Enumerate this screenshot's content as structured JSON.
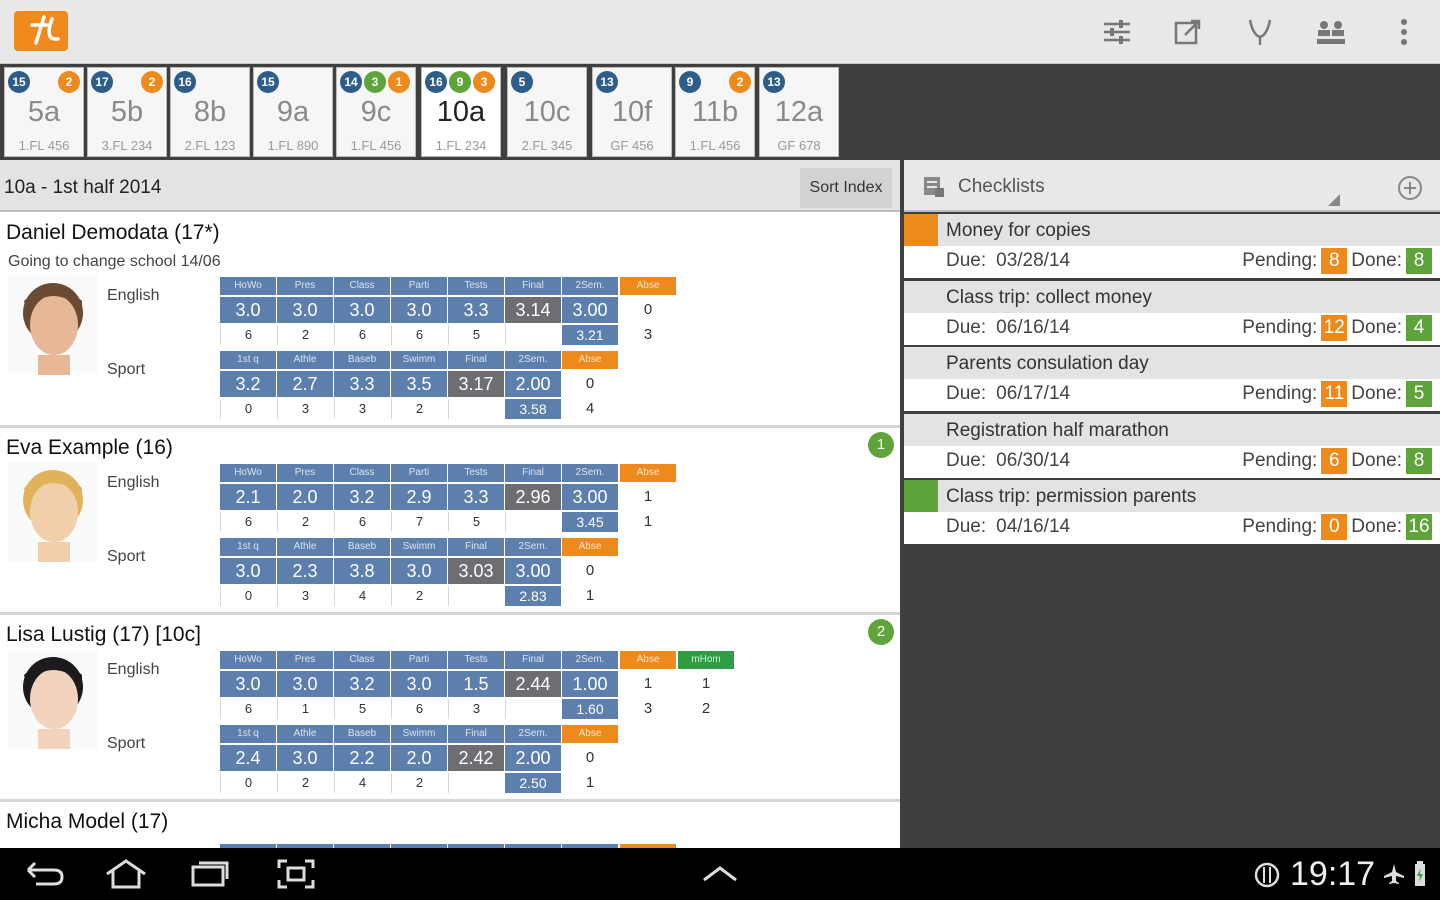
{
  "app": {
    "actions": [
      "sliders-icon",
      "export-icon",
      "fork-icon",
      "group-icon",
      "overflow-icon"
    ]
  },
  "classes": [
    {
      "name": "5a",
      "room": "1.FL 456",
      "badges": [
        {
          "v": "15",
          "c": "blue"
        },
        {
          "v": "2",
          "c": "orange"
        }
      ]
    },
    {
      "name": "5b",
      "room": "3.FL 234",
      "badges": [
        {
          "v": "17",
          "c": "blue"
        },
        {
          "v": "2",
          "c": "orange"
        }
      ]
    },
    {
      "name": "8b",
      "room": "2.FL 123",
      "badges": [
        {
          "v": "16",
          "c": "blue"
        }
      ]
    },
    {
      "name": "9a",
      "room": "1.FL 890",
      "badges": [
        {
          "v": "15",
          "c": "blue"
        }
      ]
    },
    {
      "name": "9c",
      "room": "1.FL 456",
      "badges": [
        {
          "v": "14",
          "c": "blue"
        },
        {
          "v": "3",
          "c": "green"
        },
        {
          "v": "1",
          "c": "orange"
        }
      ]
    },
    {
      "name": "10a",
      "room": "1.FL 234",
      "badges": [
        {
          "v": "16",
          "c": "blue"
        },
        {
          "v": "9",
          "c": "green"
        },
        {
          "v": "3",
          "c": "orange"
        }
      ],
      "active": true
    },
    {
      "name": "10c",
      "room": "2.FL 345",
      "badges": [
        {
          "v": "5",
          "c": "blue"
        }
      ]
    },
    {
      "name": "10f",
      "room": "GF 456",
      "badges": [
        {
          "v": "13",
          "c": "blue"
        }
      ]
    },
    {
      "name": "11b",
      "room": "1.FL 456",
      "badges": [
        {
          "v": "9",
          "c": "blue"
        },
        {
          "v": "2",
          "c": "orange"
        }
      ]
    },
    {
      "name": "12a",
      "room": "GF 678",
      "badges": [
        {
          "v": "13",
          "c": "blue"
        }
      ]
    }
  ],
  "left": {
    "title": "10a - 1st half 2014",
    "sort_label": "Sort Index"
  },
  "students": [
    {
      "name": "Daniel Demodata  (17*)",
      "note": "Going to change school 14/06",
      "badge": "",
      "english": {
        "label": "English",
        "headers": [
          "HoWo",
          "Pres",
          "Class",
          "Parti",
          "Tests",
          "Final",
          "2Sem.",
          "Abse"
        ],
        "values": [
          "3.0",
          "3.0",
          "3.0",
          "3.0",
          "3.3",
          "3.14",
          "3.00",
          "0"
        ],
        "counts": [
          "6",
          "2",
          "6",
          "6",
          "5",
          "",
          "3.21",
          "3"
        ]
      },
      "sport": {
        "label": "Sport",
        "headers": [
          "1st q",
          "Athle",
          "Baseb",
          "Swimm",
          "Final",
          "2Sem.",
          "Abse"
        ],
        "values": [
          "3.2",
          "2.7",
          "3.3",
          "3.5",
          "3.17",
          "2.00",
          "0"
        ],
        "counts": [
          "0",
          "3",
          "3",
          "2",
          "",
          "3.58",
          "4"
        ]
      }
    },
    {
      "name": "Eva Example  (16)",
      "note": "",
      "badge": "1",
      "english": {
        "label": "English",
        "headers": [
          "HoWo",
          "Pres",
          "Class",
          "Parti",
          "Tests",
          "Final",
          "2Sem.",
          "Abse"
        ],
        "values": [
          "2.1",
          "2.0",
          "3.2",
          "2.9",
          "3.3",
          "2.96",
          "3.00",
          "1"
        ],
        "counts": [
          "6",
          "2",
          "6",
          "7",
          "5",
          "",
          "3.45",
          "1"
        ]
      },
      "sport": {
        "label": "Sport",
        "headers": [
          "1st q",
          "Athle",
          "Baseb",
          "Swimm",
          "Final",
          "2Sem.",
          "Abse"
        ],
        "values": [
          "3.0",
          "2.3",
          "3.8",
          "3.0",
          "3.03",
          "3.00",
          "0"
        ],
        "counts": [
          "0",
          "3",
          "4",
          "2",
          "",
          "2.83",
          "1"
        ]
      }
    },
    {
      "name": "Lisa Lustig  (17) [10c]",
      "note": "",
      "badge": "2",
      "english": {
        "label": "English",
        "headers": [
          "HoWo",
          "Pres",
          "Class",
          "Parti",
          "Tests",
          "Final",
          "2Sem.",
          "Abse",
          "mHom"
        ],
        "values": [
          "3.0",
          "3.0",
          "3.2",
          "3.0",
          "1.5",
          "2.44",
          "1.00",
          "1",
          "1"
        ],
        "counts": [
          "6",
          "1",
          "5",
          "6",
          "3",
          "",
          "1.60",
          "3",
          "2"
        ]
      },
      "sport": {
        "label": "Sport",
        "headers": [
          "1st q",
          "Athle",
          "Baseb",
          "Swimm",
          "Final",
          "2Sem.",
          "Abse"
        ],
        "values": [
          "2.4",
          "3.0",
          "2.2",
          "2.0",
          "2.42",
          "2.00",
          "0"
        ],
        "counts": [
          "0",
          "2",
          "4",
          "2",
          "",
          "2.50",
          "1"
        ]
      }
    },
    {
      "name": "Micha Model  (17)",
      "note": "",
      "badge": ""
    }
  ],
  "checklists": {
    "title": "Checklists",
    "due_label": "Due:",
    "pending_label": "Pending:",
    "done_label": "Done:",
    "items": [
      {
        "title": "Money for copies",
        "due": "03/28/14",
        "pending": "8",
        "done": "8",
        "bar": "#ee8a1c"
      },
      {
        "title": "Class trip: collect money",
        "due": "06/16/14",
        "pending": "12",
        "done": "4",
        "bar": ""
      },
      {
        "title": "Parents consulation day",
        "due": "06/17/14",
        "pending": "11",
        "done": "5",
        "bar": ""
      },
      {
        "title": "Registration half marathon",
        "due": "06/30/14",
        "pending": "6",
        "done": "8",
        "bar": ""
      },
      {
        "title": "Class trip: permission parents",
        "due": "04/16/14",
        "pending": "0",
        "done": "16",
        "bar": "#5fa33b"
      }
    ],
    "colors": {
      "pending": "#ee8a1c",
      "done": "#5fa33b"
    }
  },
  "status": {
    "time": "19:17"
  }
}
